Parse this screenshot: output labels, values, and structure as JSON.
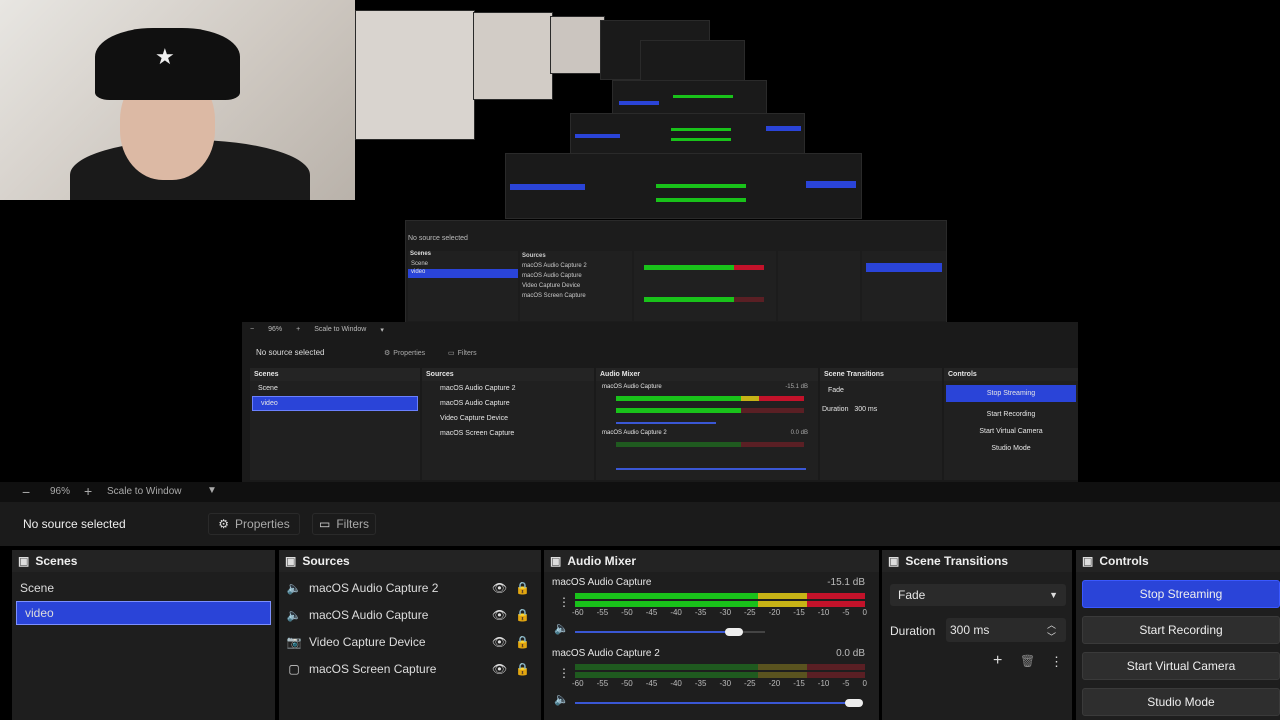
{
  "preview": {
    "mini_toolbar": {
      "zoom": "96%",
      "scale_mode": "Scale to Window"
    },
    "mini_status": "No source selected",
    "mini_properties": "Properties",
    "mini_filters": "Filters",
    "mini_scenes_title": "Scenes",
    "mini_scenes": [
      "Scene",
      "video"
    ],
    "mini_sources_title": "Sources",
    "mini_sources": [
      "macOS Audio Capture 2",
      "macOS Audio Capture",
      "Video Capture Device",
      "macOS Screen Capture"
    ],
    "mini_mixer_title": "Audio Mixer",
    "mini_mixer": [
      {
        "name": "macOS Audio Capture",
        "db": "-15.1 dB"
      },
      {
        "name": "macOS Audio Capture 2",
        "db": "0.0 dB"
      }
    ],
    "mini_transitions_title": "Scene Transitions",
    "mini_transition": "Fade",
    "mini_duration_label": "Duration",
    "mini_duration": "300 ms",
    "mini_controls_title": "Controls",
    "mini_controls": [
      "Stop Streaming",
      "Start Recording",
      "Start Virtual Camera",
      "Studio Mode"
    ]
  },
  "toolbar": {
    "zoom": "96%",
    "scale_mode": "Scale to Window"
  },
  "status": "No source selected",
  "properties_label": "Properties",
  "filters_label": "Filters",
  "scenes": {
    "title": "Scenes",
    "items": [
      "Scene",
      "video"
    ],
    "selected_index": 1
  },
  "sources": {
    "title": "Sources",
    "items": [
      {
        "name": "macOS Audio Capture 2",
        "icon": "speaker-icon"
      },
      {
        "name": "macOS Audio Capture",
        "icon": "speaker-icon"
      },
      {
        "name": "Video Capture Device",
        "icon": "camera-icon"
      },
      {
        "name": "macOS Screen Capture",
        "icon": "monitor-icon"
      }
    ]
  },
  "mixer": {
    "title": "Audio Mixer",
    "scale_labels": [
      "-60",
      "-55",
      "-50",
      "-45",
      "-40",
      "-35",
      "-30",
      "-25",
      "-20",
      "-15",
      "-10",
      "-5",
      "0"
    ],
    "channels": [
      {
        "name": "macOS Audio Capture",
        "db": "-15.1 dB",
        "volume": 0.68,
        "level": 0.55
      },
      {
        "name": "macOS Audio Capture 2",
        "db": "0.0 dB",
        "volume": 1.0,
        "level": 0.0
      }
    ]
  },
  "transitions": {
    "title": "Scene Transitions",
    "selected": "Fade",
    "duration_label": "Duration",
    "duration": "300 ms"
  },
  "controls": {
    "title": "Controls",
    "stop_streaming": "Stop Streaming",
    "start_recording": "Start Recording",
    "start_virtual_camera": "Start Virtual Camera",
    "studio_mode": "Studio Mode"
  },
  "colors": {
    "accent": "#2a44d8",
    "panel": "#1e1e1e",
    "meter_green": "#19c21a",
    "meter_yellow": "#c7b316",
    "meter_red": "#c3122a"
  }
}
